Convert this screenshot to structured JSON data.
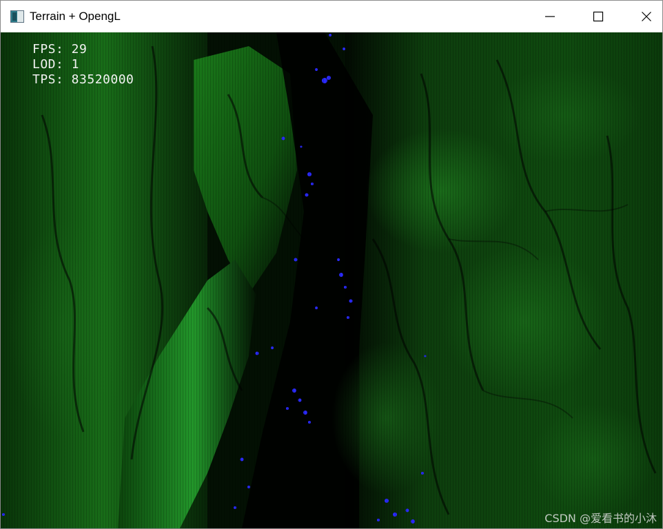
{
  "window": {
    "title": "Terrain + OpengL",
    "icons": {
      "app": "app-window-icon",
      "minimize": "minimize-icon",
      "maximize": "maximize-icon",
      "close": "close-icon"
    }
  },
  "hud": {
    "fps": "FPS: 29",
    "lod": "LOD: 1",
    "tps": "TPS: 83520000"
  },
  "watermark": "CSDN @爱看书的小沐",
  "colors": {
    "terrain_high": "#1f8f1f",
    "terrain_low": "#000000",
    "water": "#2020ff",
    "hud_text": "#f2f2f2",
    "titlebar": "#ffffff"
  }
}
